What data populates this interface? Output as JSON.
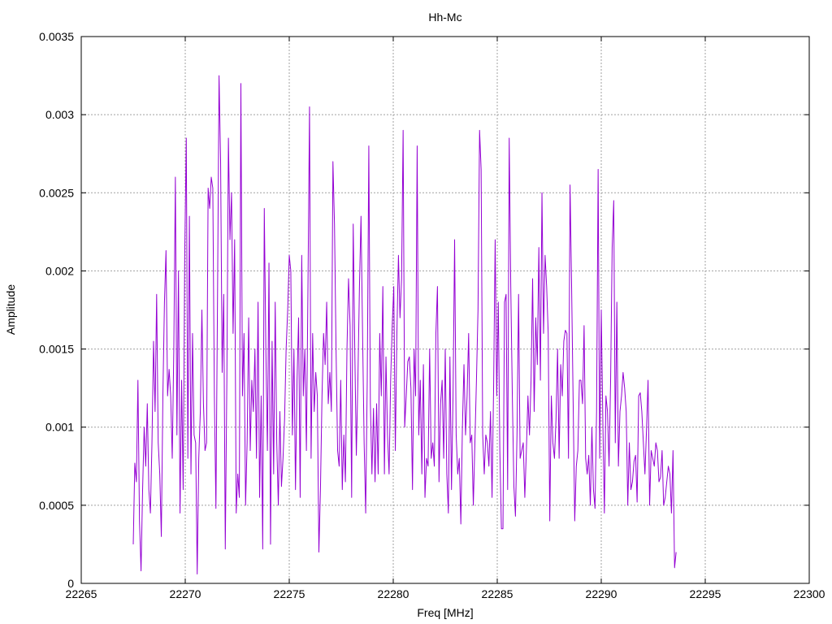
{
  "chart_data": {
    "type": "line",
    "title": "Hh-Mc",
    "xlabel": "Freq [MHz]",
    "ylabel": "Amplitude",
    "xlim": [
      22265,
      22300
    ],
    "ylim": [
      0,
      0.0035
    ],
    "xticks": [
      "22265",
      "22270",
      "22275",
      "22280",
      "22285",
      "22290",
      "22295",
      "22300"
    ],
    "yticks": [
      "0",
      "0.0005",
      "0.001",
      "0.0015",
      "0.002",
      "0.0025",
      "0.003",
      "0.0035"
    ],
    "grid": true,
    "legend": "none",
    "series": [
      {
        "color": "#9400d3",
        "x_start": 22267.5,
        "x_step": 0.075,
        "values": [
          0.00025,
          0.00077,
          0.00065,
          0.0013,
          0.0004,
          8e-05,
          0.0006,
          0.001,
          0.00075,
          0.00115,
          0.0006,
          0.00045,
          0.0009,
          0.00155,
          0.0011,
          0.00185,
          0.0009,
          0.0007,
          0.0003,
          0.0012,
          0.0018,
          0.00213,
          0.0012,
          0.00137,
          0.0012,
          0.0008,
          0.0015,
          0.0026,
          0.00095,
          0.002,
          0.00045,
          0.0013,
          0.0006,
          0.0021,
          0.00285,
          0.0008,
          0.00235,
          0.0007,
          0.0016,
          0.00095,
          0.0009,
          6e-05,
          0.0008,
          0.0011,
          0.00175,
          0.00115,
          0.00085,
          0.0009,
          0.00253,
          0.0024,
          0.0026,
          0.00253,
          0.0012,
          0.00048,
          0.0018,
          0.00325,
          0.0027,
          0.00135,
          0.00185,
          0.00022,
          0.0013,
          0.00285,
          0.0022,
          0.0025,
          0.0016,
          0.0022,
          0.00045,
          0.0007,
          0.00055,
          0.0032,
          0.0012,
          0.0016,
          0.0005,
          0.0009,
          0.0017,
          0.00085,
          0.0013,
          0.0011,
          0.0015,
          0.0008,
          0.0018,
          0.00055,
          0.0012,
          0.00022,
          0.0024,
          0.0015,
          0.00085,
          0.00205,
          0.00025,
          0.00155,
          0.0007,
          0.0018,
          0.0009,
          0.0005,
          0.0011,
          0.00062,
          0.0008,
          0.00105,
          0.0015,
          0.00175,
          0.0021,
          0.002,
          0.00095,
          0.0015,
          0.0006,
          0.0013,
          0.0017,
          0.00055,
          0.0021,
          0.0012,
          0.0015,
          0.00085,
          0.0019,
          0.00305,
          0.0008,
          0.0016,
          0.0011,
          0.00135,
          0.0012,
          0.0002,
          0.0006,
          0.0012,
          0.0016,
          0.0014,
          0.0018,
          0.00115,
          0.00135,
          0.0011,
          0.0027,
          0.0023,
          0.0015,
          0.00085,
          0.00075,
          0.0013,
          0.0006,
          0.00095,
          0.00065,
          0.0015,
          0.00195,
          0.00165,
          0.00055,
          0.0023,
          0.0015,
          0.00082,
          0.0013,
          0.0019,
          0.00235,
          0.0016,
          0.0009,
          0.00045,
          0.0013,
          0.0028,
          0.00115,
          0.0007,
          0.00112,
          0.00065,
          0.00115,
          0.0007,
          0.0016,
          0.0012,
          0.0019,
          0.0007,
          0.00145,
          0.00095,
          0.0007,
          0.0013,
          0.00165,
          0.0019,
          0.00085,
          0.0016,
          0.0021,
          0.0017,
          0.00195,
          0.0029,
          0.001,
          0.0012,
          0.00142,
          0.00145,
          0.00125,
          0.0006,
          0.0015,
          0.0012,
          0.0028,
          0.00095,
          0.0013,
          0.0007,
          0.0014,
          0.00055,
          0.0008,
          0.00075,
          0.0015,
          0.0008,
          0.0009,
          0.00075,
          0.0016,
          0.0019,
          0.00065,
          0.00115,
          0.0013,
          0.0008,
          0.0015,
          0.0007,
          0.00045,
          0.00145,
          0.0006,
          0.0012,
          0.0022,
          0.00095,
          0.0007,
          0.0008,
          0.00038,
          0.001,
          0.0014,
          0.00095,
          0.0012,
          0.0016,
          0.0009,
          0.00095,
          0.0005,
          0.0009,
          0.0013,
          0.00175,
          0.0029,
          0.00265,
          0.00095,
          0.0007,
          0.00095,
          0.0009,
          0.00075,
          0.0011,
          0.00055,
          0.00125,
          0.0022,
          0.0012,
          0.0018,
          0.00085,
          0.00035,
          0.00035,
          0.0018,
          0.00185,
          0.0006,
          0.00285,
          0.0019,
          0.0012,
          0.00062,
          0.00043,
          0.00095,
          0.00185,
          0.0008,
          0.00085,
          0.0009,
          0.00055,
          0.00085,
          0.0012,
          0.00095,
          0.0013,
          0.00195,
          0.0011,
          0.0017,
          0.0014,
          0.00215,
          0.0013,
          0.0025,
          0.0016,
          0.0021,
          0.0019,
          0.0016,
          0.0004,
          0.0012,
          0.0009,
          0.0008,
          0.00105,
          0.0015,
          0.0008,
          0.0014,
          0.0012,
          0.00155,
          0.00162,
          0.0016,
          0.0008,
          0.00255,
          0.0019,
          0.00115,
          0.0004,
          0.00075,
          0.00085,
          0.0013,
          0.0013,
          0.00115,
          0.00165,
          0.0008,
          0.0007,
          0.00082,
          0.0005,
          0.001,
          0.0006,
          0.00048,
          0.0011,
          0.00265,
          0.0008,
          0.00175,
          0.00105,
          0.00045,
          0.0012,
          0.0011,
          0.00075,
          0.0013,
          0.00215,
          0.00245,
          0.0009,
          0.0018,
          0.00075,
          0.0011,
          0.0012,
          0.00135,
          0.00125,
          0.0011,
          0.0005,
          0.0009,
          0.0006,
          0.00065,
          0.00078,
          0.00082,
          0.00052,
          0.0012,
          0.00122,
          0.0011,
          0.0009,
          0.0007,
          0.00098,
          0.0013,
          0.0005,
          0.00085,
          0.0008,
          0.00075,
          0.0009,
          0.00085,
          0.00065,
          0.00068,
          0.00085,
          0.0005,
          0.00055,
          0.00065,
          0.00075,
          0.0007,
          0.00045,
          0.00085,
          0.0001,
          0.0002
        ]
      }
    ]
  }
}
